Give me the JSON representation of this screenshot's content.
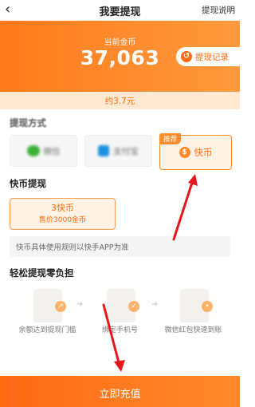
{
  "nav": {
    "back_icon": "‹",
    "title": "我要提现",
    "help": "提现说明"
  },
  "hero": {
    "caption": "当前金币",
    "coins": "37,063",
    "records_label": "提现记录",
    "approx": "约3.7元"
  },
  "method": {
    "title": "提现方式",
    "options": [
      {
        "label": "微信",
        "icon": "wechat-icon",
        "selected": false
      },
      {
        "label": "支付宝",
        "icon": "alipay-icon",
        "selected": false
      },
      {
        "label": "快币",
        "icon": "kuaibi-icon",
        "selected": true,
        "badge": "推荐"
      }
    ]
  },
  "kuaibi": {
    "title": "快币提现",
    "amount": "3快币",
    "price": "售价3000金币",
    "rule": "快币具体使用规则以快手APP为准"
  },
  "steps": {
    "title": "轻松提现零负担",
    "items": [
      {
        "label": "余额达到提现门槛",
        "icon": "balance-icon"
      },
      {
        "label": "绑定手机号",
        "icon": "phone-bind-icon"
      },
      {
        "label": "微信红包快速到账",
        "icon": "wechat-redpacket-icon"
      }
    ]
  },
  "cta": {
    "label": "立即充值"
  },
  "colors": {
    "accent": "#ff6b10",
    "annotation_arrow": "#e8161b"
  }
}
